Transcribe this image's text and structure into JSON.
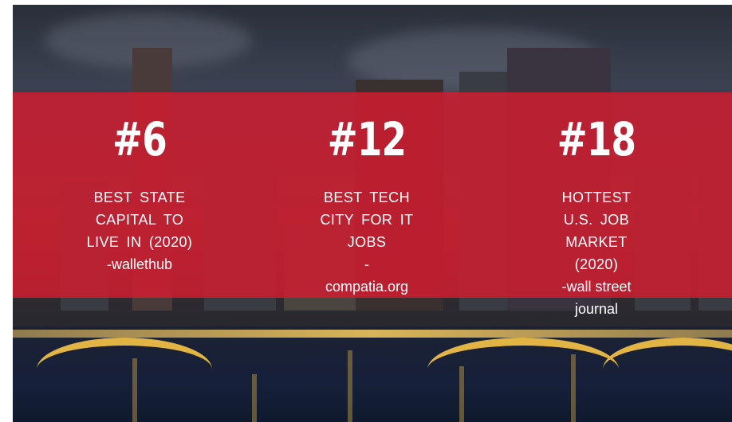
{
  "stats": [
    {
      "rank": "#6",
      "lines": [
        "BEST STATE",
        "CAPITAL TO",
        "LIVE IN (2020)"
      ],
      "source": "-wallethub"
    },
    {
      "rank": "#12",
      "lines": [
        "BEST TECH",
        "CITY FOR IT",
        "JOBS"
      ],
      "source": "-",
      "source2": "compatia.org"
    },
    {
      "rank": "#18",
      "lines": [
        "HOTTEST",
        "U.S. JOB",
        "MARKET",
        "(2020)"
      ],
      "source": "-wall street",
      "source2": "journal"
    }
  ],
  "colors": {
    "band": "#d61c30",
    "text": "#ffffff"
  }
}
